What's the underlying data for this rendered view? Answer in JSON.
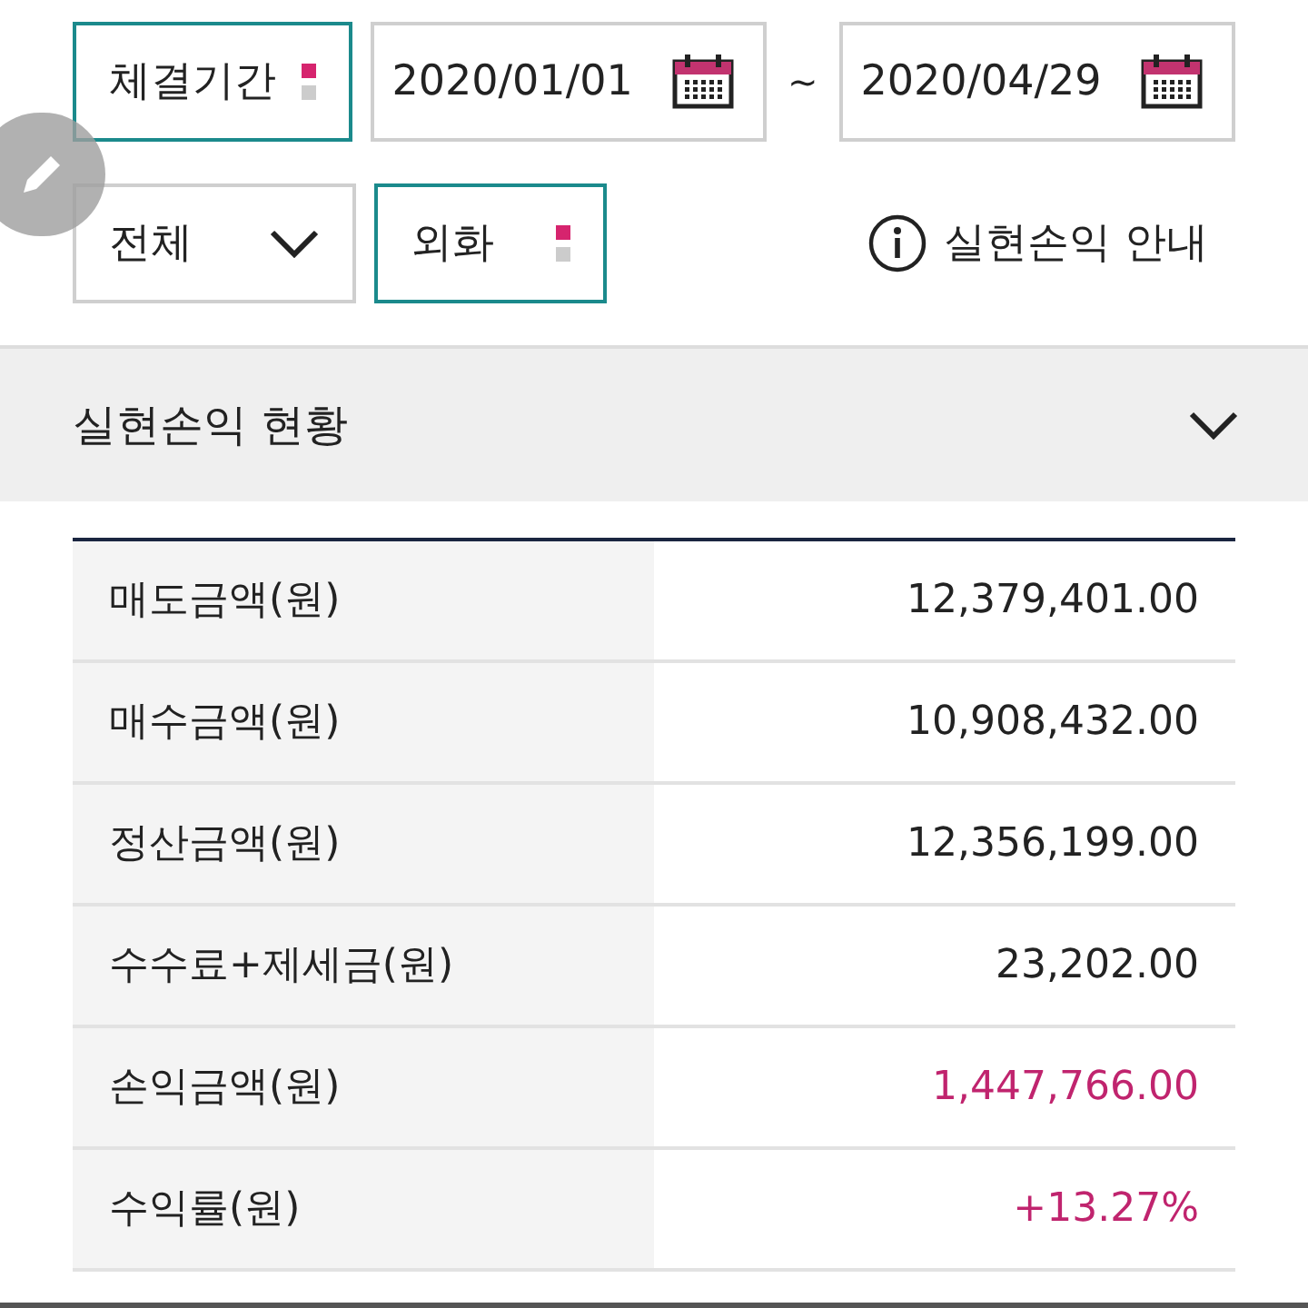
{
  "period": {
    "label": "체결기간",
    "start_date": "2020/01/01",
    "separator": "~",
    "end_date": "2020/04/29"
  },
  "filters": [
    {
      "kind": "dropdown",
      "value": "전체"
    },
    {
      "kind": "picker",
      "value": "외화"
    }
  ],
  "info_link": "실현손익 안내",
  "section": {
    "title": "실현손익 현황",
    "expanded": true
  },
  "rows": [
    {
      "label": "매도금액(원)",
      "value": "12,379,401.00",
      "color": "#222222"
    },
    {
      "label": "매수금액(원)",
      "value": "10,908,432.00",
      "color": "#222222"
    },
    {
      "label": "정산금액(원)",
      "value": "12,356,199.00",
      "color": "#222222"
    },
    {
      "label": "수수료+제세금(원)",
      "value": "23,202.00",
      "color": "#222222"
    },
    {
      "label": "손익금액(원)",
      "value": "1,447,766.00",
      "color": "#c0246e"
    },
    {
      "label": "수익률(원)",
      "value": "+13.27%",
      "color": "#c0246e"
    }
  ]
}
